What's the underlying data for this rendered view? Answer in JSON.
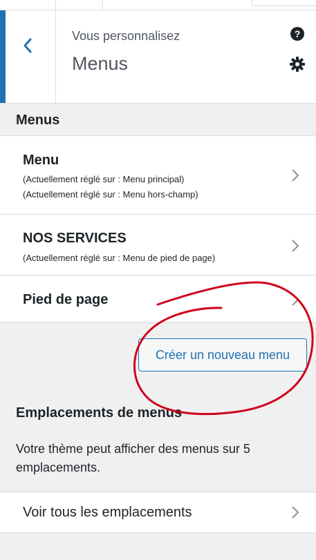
{
  "header": {
    "subtitle": "Vous personnalisez",
    "title": "Menus"
  },
  "section": {
    "title": "Menus"
  },
  "menus": [
    {
      "name": "Menu",
      "lines": [
        "(Actuellement réglé sur : Menu principal)",
        "(Actuellement réglé sur : Menu hors-champ)"
      ]
    },
    {
      "name": "NOS SERVICES",
      "lines": [
        "(Actuellement réglé sur : Menu de pied de page)"
      ]
    },
    {
      "name": "Pied de page",
      "lines": []
    }
  ],
  "create_button": "Créer un nouveau menu",
  "locations": {
    "title": "Emplacements de menus",
    "description": "Votre thème peut afficher des menus sur 5 emplacements.",
    "link": "Voir tous les emplacements"
  },
  "colors": {
    "accent": "#2271b1",
    "annotation": "#d0021b"
  },
  "icons": {
    "back": "chevron-left-icon",
    "help": "help-icon",
    "settings": "gear-icon",
    "row": "chevron-right-icon"
  }
}
